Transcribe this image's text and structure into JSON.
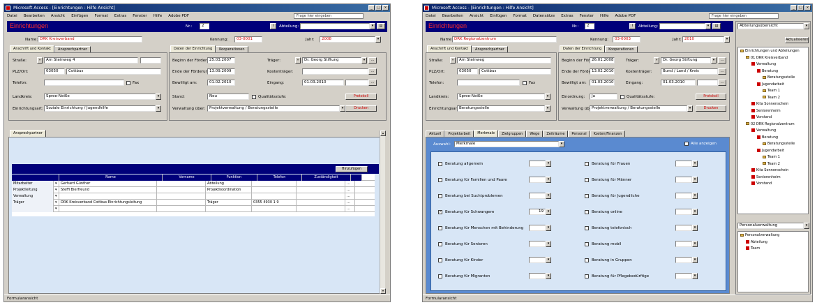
{
  "left": {
    "title": "Microsoft Access - [Einrichtungen : Hilfe Ansicht]",
    "menu": [
      "Datei",
      "Bearbeiten",
      "Ansicht",
      "Einfügen",
      "Format",
      "Extras",
      "Fenster",
      "Hilfe",
      "Adobe PDF"
    ],
    "help_placeholder": "Frage hier eingeben",
    "form_title": "Einrichtungen",
    "nr_label": "Nr.:",
    "nr_value": "2",
    "filter_label": "Abteilung:",
    "filter_value": "",
    "name_label": "Name:",
    "name_value": "DRK Kreisverband",
    "kennung_label": "Kennung:",
    "kennung_value": "03-0001",
    "jahr_label": "Jahr:",
    "jahr_value": "2008",
    "tabs_left": [
      "Anschrift und Kontakt",
      "Ansprechpartner"
    ],
    "tabs_right": [
      "Daten der Einrichtung",
      "Kooperationen"
    ],
    "strasse_label": "Straße:",
    "strasse_value": "Am Steinweg 4",
    "plz_label": "PLZ/Ort:",
    "plz_value": "03050",
    "ort_value": "Cottbus",
    "telefon_label": "Telefon:",
    "fax_label": "Fax",
    "land_label": "Landkreis:",
    "land_value": "Spree-Neiße",
    "einrichtung_label": "Einrichtungsart:",
    "einrichtung_value": "Soziale Einrichtung / Jugendhilfe",
    "start_label": "Beginn der Förderung:",
    "start_value": "25.03.2007",
    "ende_label": "Ende der Förderung:",
    "ende_value": "13.09.2009",
    "bewilligt_label": "Bewilligt am:",
    "bewilligt_value": "01.02.2010",
    "traeger_label": "Träger:",
    "traeger_value": "Dr. Georg Stiftung",
    "kosten_label": "Kostenträger:",
    "kosten_value": "",
    "eingang_label": "Eingang:",
    "eingang_value": "01.03.2010",
    "stand_label": "Stand:",
    "stand_value": "Neu",
    "qualitaet_label": "Qualitätsstufe:",
    "qualitaet_value": "",
    "verwaltung_label": "Verwaltung über:",
    "verwaltung_value": "Projektverwaltung / Beratungsstelle",
    "action1": "Protokoll",
    "action2": "Drucken",
    "subtab": "Ansprechpartner",
    "add_button": "Hinzufügen",
    "grid_headers": [
      "Name",
      "Vorname",
      "Funktion",
      "Telefon",
      "Zuständigkeit"
    ],
    "grid_rows": [
      [
        "Mitarbeiter",
        "Gerhard Günther",
        "",
        "Abteilung",
        "",
        ""
      ],
      [
        "Projektleitung",
        "Steffi Bierfreund",
        "",
        "Projektkoordination",
        "",
        ""
      ],
      [
        "Verwaltung",
        "",
        "",
        "",
        "",
        ""
      ],
      [
        "Träger",
        "DRK Kreisverband Cottbus Einrichtungsleitung",
        "",
        "Träger",
        "0355 4930 1 9",
        ""
      ],
      [
        "",
        "",
        "",
        "",
        "",
        ""
      ]
    ],
    "status": "Formularansicht"
  },
  "right": {
    "title": "Microsoft Access - [Einrichtungen : Hilfe Ansicht]",
    "menu": [
      "Datei",
      "Bearbeiten",
      "Ansicht",
      "Einfügen",
      "Format",
      "Datensätze",
      "Extras",
      "Fenster",
      "Hilfe",
      "Adobe PDF"
    ],
    "help_placeholder": "Frage hier eingeben",
    "form_title": "Einrichtungen",
    "nr_label": "Nr.:",
    "nr_value": "2",
    "filter_label": "Abteilung:",
    "name_label": "Name:",
    "name_value": "DRK Regionalzentrum",
    "kennung_label": "Kennung:",
    "kennung_value": "03-0003",
    "jahr_label": "Jahr:",
    "jahr_value": "2010",
    "tabs_left": [
      "Anschrift und Kontakt",
      "Ansprechpartner"
    ],
    "tabs_right": [
      "Daten der Einrichtung",
      "Kooperationen"
    ],
    "strasse_label": "Straße:",
    "strasse_value": "Am Steinweg",
    "plz_label": "PLZ/Ort:",
    "plz_value": "03050",
    "ort_value": "Cottbus",
    "telefon_label": "Telefon:",
    "fax_label": "Fax",
    "land_label": "Landkreis:",
    "land_value": "Spree-Neiße",
    "einrichtung_label": "Einrichtungsart:",
    "einrichtung_value": "Beratungsstelle",
    "start_label": "Beginn der Förderung:",
    "start_value": "26.01.2008",
    "ende_label": "Ende der Förderung:",
    "ende_value": "13.02.2010",
    "bewilligt_label": "Bewilligt am:",
    "bewilligt_value": "01.03.2010",
    "traeger_label": "Träger:",
    "traeger_value": "Dr. Georg Stiftung",
    "kosten_label": "Kostenträger:",
    "kosten_value": "Bund / Land / Kreis",
    "eingang_label": "Eingang:",
    "eingang_value": "01.03.2010",
    "stand_label": "Einordnung:",
    "stand_value": "Ja",
    "qualitaet_label": "Qualitätsstufe:",
    "verwaltung_label": "Verwaltung über:",
    "verwaltung_value": "Projektverwaltung / Beratungsstelle",
    "action1": "Protokoll",
    "action2": "Drucken",
    "subtabs": [
      "Aktuell",
      "Projektarbeit",
      "Merkmale",
      "Zielgruppen",
      "Wege",
      "Zeiträume",
      "Personal",
      "Kosten/Finanzen"
    ],
    "combo_label": "Auswahl:",
    "combo_value": "Merkmale",
    "all_label": "Alle anzeigen",
    "checks_left": [
      {
        "label": "Beratung allgemein",
        "checked": false,
        "value": ""
      },
      {
        "label": "Beratung für Familien und Paare",
        "checked": false,
        "value": ""
      },
      {
        "label": "Beratung bei Suchtproblemen",
        "checked": false,
        "value": ""
      },
      {
        "label": "Beratung für Schwangere",
        "checked": true,
        "value": "19"
      },
      {
        "label": "Beratung für Menschen mit Behinderung",
        "checked": false,
        "value": ""
      },
      {
        "label": "Beratung für Senioren",
        "checked": false,
        "value": ""
      },
      {
        "label": "Beratung für Kinder",
        "checked": false,
        "value": ""
      },
      {
        "label": "Beratung für Migranten",
        "checked": false,
        "value": ""
      }
    ],
    "checks_right": [
      {
        "label": "Beratung für Frauen",
        "checked": false,
        "value": ""
      },
      {
        "label": "Beratung für Männer",
        "checked": false,
        "value": ""
      },
      {
        "label": "Beratung für Jugendliche",
        "checked": false,
        "value": ""
      },
      {
        "label": "Beratung online",
        "checked": false,
        "value": ""
      },
      {
        "label": "Beratung telefonisch",
        "checked": false,
        "value": ""
      },
      {
        "label": "Beratung mobil",
        "checked": false,
        "value": ""
      },
      {
        "label": "Beratung in Gruppen",
        "checked": false,
        "value": ""
      },
      {
        "label": "Beratung für Pflegebedürftige",
        "checked": false,
        "value": ""
      }
    ],
    "side_combo": "Abteilungsübersicht",
    "side_button": "Aktualisieren",
    "tree": [
      {
        "label": "Einrichtungen und Abteilungen",
        "icon": "folder",
        "depth": 0
      },
      {
        "label": "01 DRK Kreisverband",
        "icon": "folder",
        "depth": 1
      },
      {
        "label": "Verwaltung",
        "icon": "red",
        "depth": 2
      },
      {
        "label": "Beratung",
        "icon": "red",
        "depth": 3
      },
      {
        "label": "Beratungsstelle",
        "icon": "folder",
        "depth": 4
      },
      {
        "label": "Jugendarbeit",
        "icon": "red",
        "depth": 3
      },
      {
        "label": "Team 1",
        "icon": "folder",
        "depth": 4
      },
      {
        "label": "Team 2",
        "icon": "folder",
        "depth": 4
      },
      {
        "label": "Kita Sonnenschein",
        "icon": "red",
        "depth": 2
      },
      {
        "label": "Seniorenheim",
        "icon": "red",
        "depth": 2
      },
      {
        "label": "Vorstand",
        "icon": "red",
        "depth": 2
      },
      {
        "label": "02 DRK Regionalzentrum",
        "icon": "folder",
        "depth": 1
      },
      {
        "label": "Verwaltung",
        "icon": "red",
        "depth": 2
      },
      {
        "label": "Beratung",
        "icon": "red",
        "depth": 3
      },
      {
        "label": "Beratungsstelle",
        "icon": "folder",
        "depth": 4
      },
      {
        "label": "Jugendarbeit",
        "icon": "red",
        "depth": 3
      },
      {
        "label": "Team 1",
        "icon": "folder",
        "depth": 4
      },
      {
        "label": "Team 2",
        "icon": "folder",
        "depth": 4
      },
      {
        "label": "Kita Sonnenschein",
        "icon": "red",
        "depth": 2
      },
      {
        "label": "Seniorenheim",
        "icon": "red",
        "depth": 2
      },
      {
        "label": "Vorstand",
        "icon": "red",
        "depth": 2
      }
    ],
    "side_combo2": "Personalverwaltung",
    "tree2": [
      {
        "label": "Personalverwaltung",
        "icon": "folder",
        "depth": 0
      },
      {
        "label": "Abteilung",
        "icon": "red",
        "depth": 1
      },
      {
        "label": "Team",
        "icon": "red",
        "depth": 1
      }
    ],
    "status": "Formularansicht"
  },
  "colors": {
    "accent": "#00007a",
    "title_red": "#ff2a2a",
    "panel_blue": "#5a8ad0"
  }
}
